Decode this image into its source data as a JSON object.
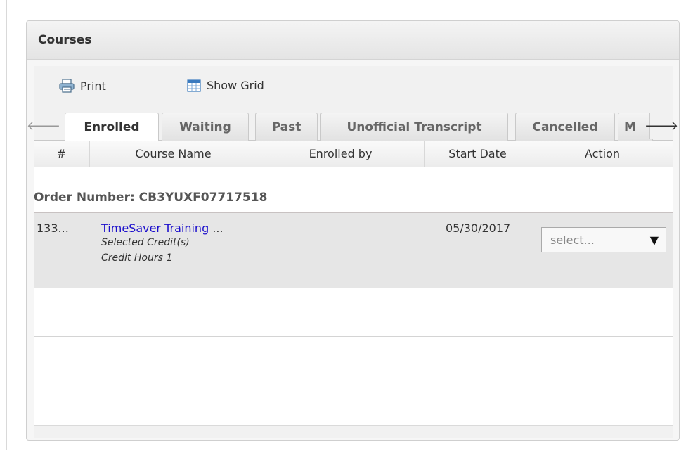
{
  "panel": {
    "title": "Courses"
  },
  "toolbar": {
    "print_label": "Print",
    "show_grid_label": "Show Grid"
  },
  "tabs": [
    {
      "label": "Enrolled",
      "active": true
    },
    {
      "label": "Waiting"
    },
    {
      "label": "Past"
    },
    {
      "label": "Unofficial Transcript"
    },
    {
      "label": "Cancelled"
    },
    {
      "label": "M"
    }
  ],
  "scroll": {
    "left_icon": "arrow-left-icon",
    "right_icon": "arrow-right-icon"
  },
  "grid": {
    "columns": [
      "#",
      "Course Name",
      "Enrolled by",
      "Start Date",
      "Action"
    ],
    "group_label": "Order Number: CB3YUXF07717518",
    "rows": [
      {
        "number": "133...",
        "course_name": "TimeSaver Training ",
        "course_ellipsis": "...",
        "credit_selected": "Selected Credit(s)",
        "credit_hours": "Credit Hours 1",
        "enrolled_by": "",
        "start_date": "05/30/2017",
        "action_value": "select...",
        "action_arrow": "▼"
      }
    ]
  }
}
